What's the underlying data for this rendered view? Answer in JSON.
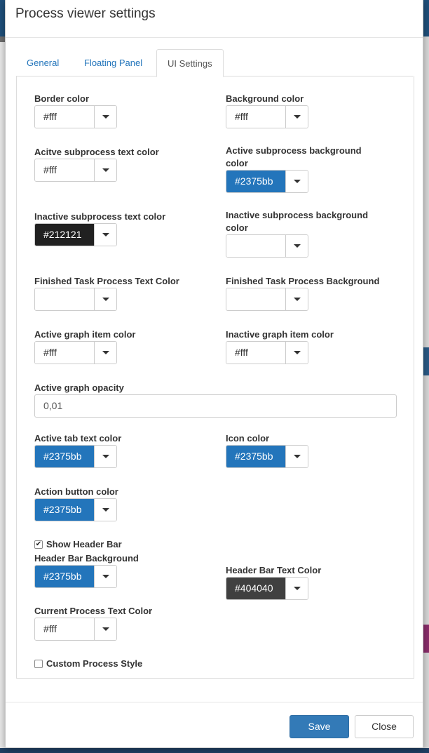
{
  "colors": {
    "primary": "#2375bb",
    "dark_swatch": "#212121",
    "header_text_swatch": "#404040",
    "save_button": "#337ab7"
  },
  "modal": {
    "title": "Process viewer settings"
  },
  "tabs": [
    {
      "label": "General",
      "active": false
    },
    {
      "label": "Floating Panel",
      "active": false
    },
    {
      "label": "UI Settings",
      "active": true
    }
  ],
  "fields": {
    "border_color": {
      "label": "Border color",
      "value": "#fff"
    },
    "background_color": {
      "label": "Background color",
      "value": "#fff"
    },
    "active_subprocess_text_color": {
      "label": "Acitve subprocess text color",
      "value": "#fff"
    },
    "active_subprocess_background_color": {
      "label": "Active subprocess background color",
      "value": "#2375bb"
    },
    "inactive_subprocess_text_color": {
      "label": "Inactive subprocess text color",
      "value": "#212121"
    },
    "inactive_subprocess_background_color": {
      "label": "Inactive subprocess background color",
      "value": ""
    },
    "finished_task_process_text_color": {
      "label": "Finished Task Process Text Color",
      "value": ""
    },
    "finished_task_process_background": {
      "label": "Finished Task Process Background",
      "value": ""
    },
    "active_graph_item_color": {
      "label": "Active graph item color",
      "value": "#fff"
    },
    "inactive_graph_item_color": {
      "label": "Inactive graph item color",
      "value": "#fff"
    },
    "active_graph_opacity": {
      "label": "Active graph opacity",
      "value": "0,01"
    },
    "active_tab_text_color": {
      "label": "Active tab text color",
      "value": "#2375bb"
    },
    "icon_color": {
      "label": "Icon color",
      "value": "#2375bb"
    },
    "action_button_color": {
      "label": "Action button color",
      "value": "#2375bb"
    },
    "show_header_bar": {
      "label": "Show Header Bar",
      "checked": true
    },
    "header_bar_background": {
      "label": "Header Bar Background",
      "value": "#2375bb"
    },
    "header_bar_text_color": {
      "label": "Header Bar Text Color",
      "value": "#404040"
    },
    "current_process_text_color": {
      "label": "Current Process Text Color",
      "value": "#fff"
    },
    "custom_process_style": {
      "label": "Custom Process Style",
      "checked": false
    }
  },
  "footer": {
    "save_label": "Save",
    "close_label": "Close"
  }
}
